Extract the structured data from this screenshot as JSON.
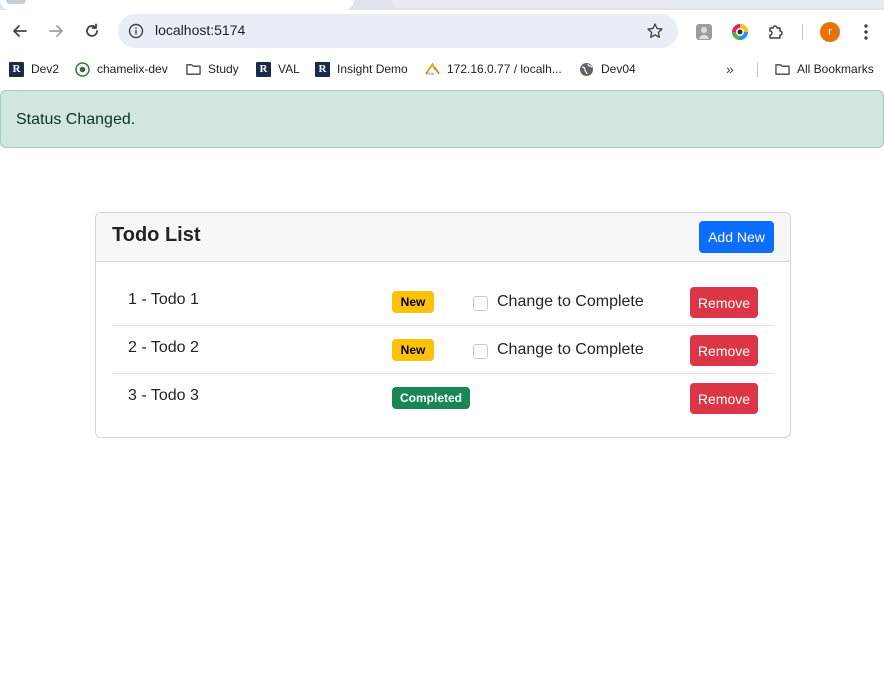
{
  "browser": {
    "url": "localhost:5174",
    "profile_initial": "r",
    "bookmarks": [
      {
        "label": "Dev2",
        "icon": "ri-logo-icon"
      },
      {
        "label": "chamelix-dev",
        "icon": "chamelix-icon"
      },
      {
        "label": "Study",
        "icon": "folder-icon"
      },
      {
        "label": "VAL",
        "icon": "ri-logo-icon"
      },
      {
        "label": "Insight Demo",
        "icon": "ri-logo-icon"
      },
      {
        "label": "172.16.0.77 / localh...",
        "icon": "phpmyadmin-icon"
      },
      {
        "label": "Dev04",
        "icon": "globe-icon"
      }
    ],
    "bookmarks_more": "»",
    "all_bookmarks": "All Bookmarks"
  },
  "alert": {
    "message": "Status Changed."
  },
  "todo": {
    "title": "Todo List",
    "add_button": "Add New",
    "items": [
      {
        "label": "1 - Todo 1",
        "status": "New",
        "toggle_label": "Change to Complete",
        "remove": "Remove"
      },
      {
        "label": "2 - Todo 2",
        "status": "New",
        "toggle_label": "Change to Complete",
        "remove": "Remove"
      },
      {
        "label": "3 - Todo 3",
        "status": "Completed",
        "remove": "Remove"
      }
    ]
  },
  "colors": {
    "primary": "#0d6efd",
    "danger": "#dc3545",
    "warning": "#ffc107",
    "success": "#198754",
    "alert_bg": "#d1e7dd"
  }
}
